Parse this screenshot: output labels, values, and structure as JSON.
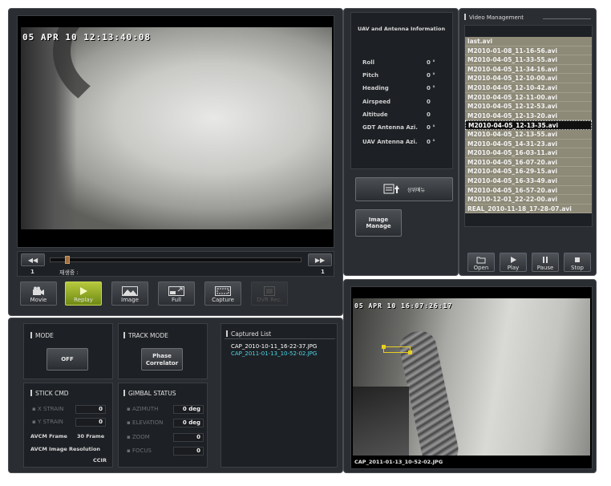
{
  "video_main": {
    "timestamp": "05 APR 10 12:13:40:08",
    "time_left": "1",
    "time_right": "1",
    "status_label": "재생중 :"
  },
  "toolbar": {
    "movie": "Movie",
    "replay": "Replay",
    "image": "Image",
    "full": "Full",
    "capture": "Capture",
    "disabled_btn": "DVR Rec."
  },
  "uav_info": {
    "title": "UAV and Antenna Information",
    "rows": [
      {
        "label": "Roll",
        "value": "0 °"
      },
      {
        "label": "Pitch",
        "value": "0 °"
      },
      {
        "label": "Heading",
        "value": "0 °"
      },
      {
        "label": "Airspeed",
        "value": "0"
      },
      {
        "label": "Altitude",
        "value": "0"
      },
      {
        "label": "GDT Antenna Azi.",
        "value": "0 °"
      },
      {
        "label": "UAV Antenna Azi.",
        "value": "0 °"
      }
    ],
    "upload_label": "상위메뉴",
    "image_manage": "Image Manage"
  },
  "video_management": {
    "title": "Video Management",
    "files": [
      "last.avi",
      "M2010-01-08_11-16-56.avi",
      "M2010-04-05_11-33-55.avi",
      "M2010-04-05_11-34-16.avi",
      "M2010-04-05_12-10-00.avi",
      "M2010-04-05_12-10-42.avi",
      "M2010-04-05_12-11-00.avi",
      "M2010-04-05_12-12-53.avi",
      "M2010-04-05_12-13-20.avi",
      "M2010-04-05_12-13-35.avi",
      "M2010-04-05_12-13-55.avi",
      "M2010-04-05_14-31-23.avi",
      "M2010-04-05_16-03-11.avi",
      "M2010-04-05_16-07-20.avi",
      "M2010-04-05_16-29-15.avi",
      "M2010-04-05_16-33-49.avi",
      "M2010-04-05_16-57-20.avi",
      "M2010-12-01_22-22-00.avi",
      "REAL_2010-11-18_17-28-07.avi"
    ],
    "selected_index": 9,
    "buttons": {
      "open": "Open",
      "play": "Play",
      "pause": "Pause",
      "stop": "Stop"
    }
  },
  "mode": {
    "title": "MODE",
    "button": "OFF"
  },
  "track_mode": {
    "title": "TRACK MODE",
    "button": "Phase Correlator"
  },
  "stick_cmd": {
    "title": "STICK CMD",
    "x_strain_label": "X STRAIN",
    "x_strain": "0",
    "y_strain_label": "Y STRAIN",
    "y_strain": "0",
    "avcm_frame_label": "AVCM Frame",
    "avcm_frame": "30 Frame",
    "avcm_res_label": "AVCM Image Resolution",
    "avcm_res": "CCIR"
  },
  "gimbal_status": {
    "title": "GIMBAL STATUS",
    "azimuth_label": "AZIMUTH",
    "azimuth": "0 deg",
    "elevation_label": "ELEVATION",
    "elevation": "0 deg",
    "zoom_label": "ZOOM",
    "zoom": "0",
    "focus_label": "FOCUS",
    "focus": "0"
  },
  "captured_list": {
    "title": "Captured List",
    "items": [
      "CAP_2010-10-11_16-22-37.JPG",
      "CAP_2011-01-13_10-52-02.JPG"
    ]
  },
  "capture_preview": {
    "timestamp": "05 APR 10 16:07:26:17",
    "filename": "CAP_2011-01-13_10-52-02.JPG"
  },
  "colors": {
    "selected_capture": "#4fd6e8",
    "accent_green": "#9fb82a"
  }
}
